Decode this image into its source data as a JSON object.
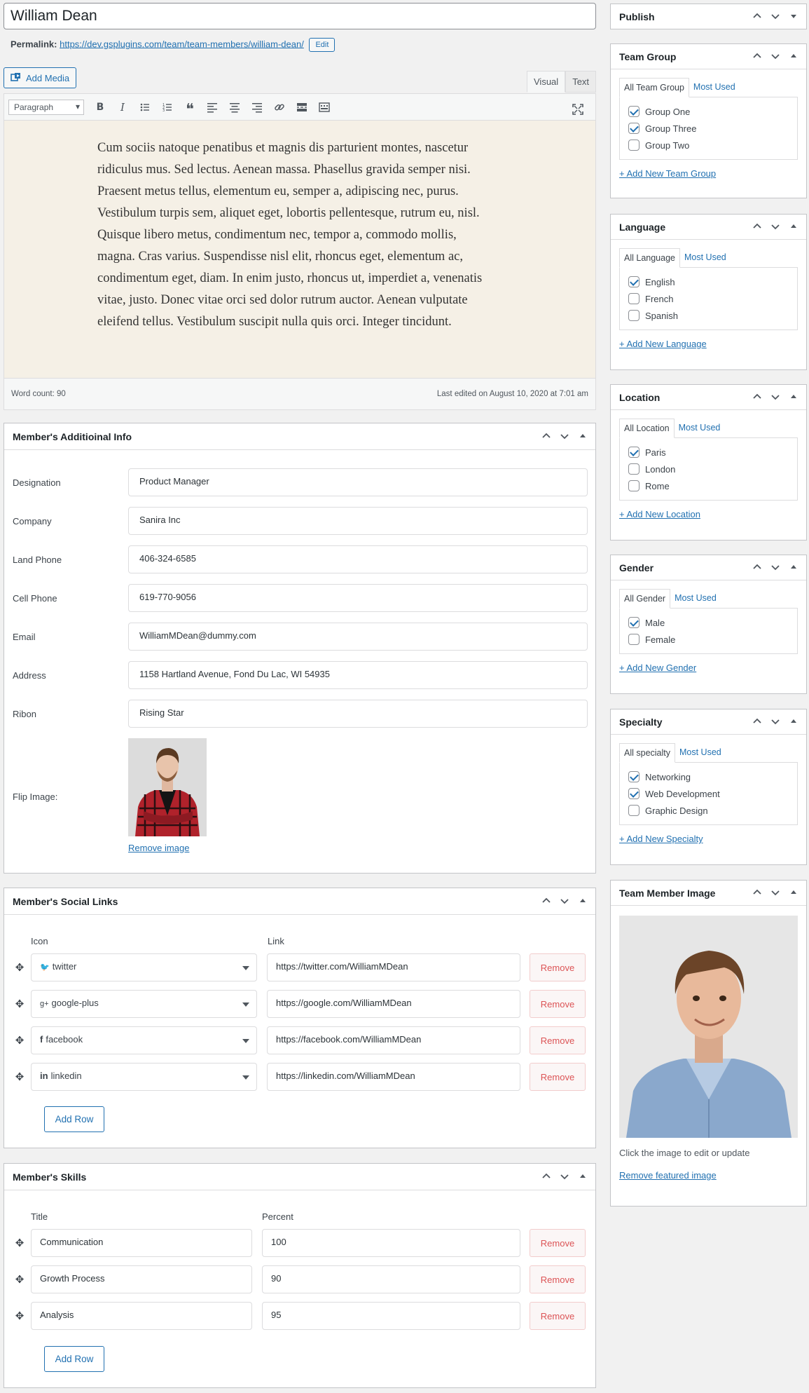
{
  "post": {
    "title": "William Dean",
    "permalink_label": "Permalink:",
    "permalink_url": "https://dev.gsplugins.com/team/team-members/william-dean/",
    "edit_label": "Edit"
  },
  "editor": {
    "add_media_label": "Add Media",
    "tab_visual": "Visual",
    "tab_text": "Text",
    "format_select": "Paragraph",
    "body": "Cum sociis natoque penatibus et magnis dis parturient montes, nascetur ridiculus mus. Sed lectus. Aenean massa. Phasellus gravida semper nisi. Praesent metus tellus, elementum eu, semper a, adipiscing nec, purus. Vestibulum turpis sem, aliquet eget, lobortis pellentesque, rutrum eu, nisl. Quisque libero metus, condimentum nec, tempor a, commodo mollis, magna. Cras varius. Suspendisse nisl elit, rhoncus eget, elementum ac, condimentum eget, diam. In enim justo, rhoncus ut, imperdiet a, venenatis vitae, justo. Donec vitae orci sed dolor rutrum auctor. Aenean vulputate eleifend tellus. Vestibulum suscipit nulla quis orci. Integer tincidunt.",
    "word_count": "Word count: 90",
    "last_edited": "Last edited on August 10, 2020 at 7:01 am",
    "toolbar_icons": [
      "bold-icon",
      "italic-icon",
      "bulleted-list-icon",
      "numbered-list-icon",
      "blockquote-icon",
      "align-left-icon",
      "align-center-icon",
      "align-right-icon",
      "link-icon",
      "read-more-icon",
      "toolbar-toggle-icon",
      "fullscreen-icon"
    ]
  },
  "additional_info": {
    "title": "Member's Additioinal Info",
    "fields": [
      {
        "label": "Designation",
        "value": "Product Manager"
      },
      {
        "label": "Company",
        "value": "Sanira Inc"
      },
      {
        "label": "Land Phone",
        "value": "406-324-6585"
      },
      {
        "label": "Cell Phone",
        "value": "619-770-9056"
      },
      {
        "label": "Email",
        "value": "WilliamMDean@dummy.com"
      },
      {
        "label": "Address",
        "value": "1158 Hartland Avenue, Fond Du Lac, WI 54935"
      },
      {
        "label": "Ribon",
        "value": "Rising Star"
      }
    ],
    "flip_image_label": "Flip Image:",
    "remove_image_label": "Remove image"
  },
  "social_links": {
    "title": "Member's Social Links",
    "col_icon": "Icon",
    "col_link": "Link",
    "rows": [
      {
        "icon_glyph": "🐦",
        "icon": "twitter",
        "link": "https://twitter.com/WilliamMDean"
      },
      {
        "icon_glyph": "g+",
        "icon": "google-plus",
        "link": "https://google.com/WilliamMDean"
      },
      {
        "icon_glyph": "f",
        "icon": "facebook",
        "link": "https://facebook.com/WilliamMDean"
      },
      {
        "icon_glyph": "in",
        "icon": "linkedin",
        "link": "https://linkedin.com/WilliamMDean"
      }
    ],
    "remove_label": "Remove",
    "add_row_label": "Add Row"
  },
  "skills": {
    "title": "Member's Skills",
    "col_title": "Title",
    "col_percent": "Percent",
    "rows": [
      {
        "title": "Communication",
        "percent": "100"
      },
      {
        "title": "Growth Process",
        "percent": "90"
      },
      {
        "title": "Analysis",
        "percent": "95"
      }
    ],
    "remove_label": "Remove",
    "add_row_label": "Add Row"
  },
  "sidebar": {
    "publish": {
      "title": "Publish"
    },
    "team_group": {
      "title": "Team Group",
      "tab_all": "All Team Group",
      "tab_most": "Most Used",
      "items": [
        {
          "label": "Group One",
          "checked": true
        },
        {
          "label": "Group Three",
          "checked": true
        },
        {
          "label": "Group Two",
          "checked": false
        }
      ],
      "add_new": "+ Add New Team Group"
    },
    "language": {
      "title": "Language",
      "tab_all": "All Language",
      "tab_most": "Most Used",
      "items": [
        {
          "label": "English",
          "checked": true
        },
        {
          "label": "French",
          "checked": false
        },
        {
          "label": "Spanish",
          "checked": false
        }
      ],
      "add_new": "+ Add New Language"
    },
    "location": {
      "title": "Location",
      "tab_all": "All Location",
      "tab_most": "Most Used",
      "items": [
        {
          "label": "Paris",
          "checked": true
        },
        {
          "label": "London",
          "checked": false
        },
        {
          "label": "Rome",
          "checked": false
        }
      ],
      "add_new": "+ Add New Location"
    },
    "gender": {
      "title": "Gender",
      "tab_all": "All Gender",
      "tab_most": "Most Used",
      "items": [
        {
          "label": "Male",
          "checked": true
        },
        {
          "label": "Female",
          "checked": false
        }
      ],
      "add_new": "+ Add New Gender"
    },
    "specialty": {
      "title": "Specialty",
      "tab_all": "All specialty",
      "tab_most": "Most Used",
      "items": [
        {
          "label": "Networking",
          "checked": true
        },
        {
          "label": "Web Development",
          "checked": true
        },
        {
          "label": "Graphic Design",
          "checked": false
        }
      ],
      "add_new": "+ Add New Specialty"
    },
    "featured_image": {
      "title": "Team Member Image",
      "hint": "Click the image to edit or update",
      "remove": "Remove featured image"
    }
  },
  "colors": {
    "accent": "#2271b1",
    "remove": "#d63638",
    "editor_bg": "#f5f0e6"
  }
}
